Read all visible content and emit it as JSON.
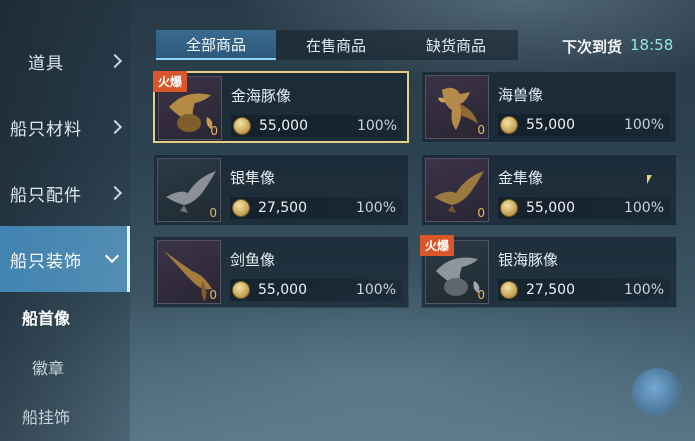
{
  "sidebar": {
    "categories": [
      {
        "label": "道具"
      },
      {
        "label": "船只材料"
      },
      {
        "label": "船只配件"
      },
      {
        "label": "船只装饰"
      }
    ],
    "subcategories": [
      {
        "label": "船首像"
      },
      {
        "label": "徽章"
      },
      {
        "label": "船挂饰"
      }
    ]
  },
  "tabs": [
    {
      "label": "全部商品"
    },
    {
      "label": "在售商品"
    },
    {
      "label": "缺货商品"
    }
  ],
  "restock": {
    "label": "下次到货",
    "time": "18:58"
  },
  "items": [
    {
      "name": "金海豚像",
      "price": "55,000",
      "percent": "100%",
      "count": "0",
      "badge": "火爆",
      "icon": "golden-dolphin-figurehead"
    },
    {
      "name": "海兽像",
      "price": "55,000",
      "percent": "100%",
      "count": "0",
      "badge": "",
      "icon": "sea-beast-figurehead"
    },
    {
      "name": "银隼像",
      "price": "27,500",
      "percent": "100%",
      "count": "0",
      "badge": "",
      "icon": "silver-falcon-figurehead"
    },
    {
      "name": "金隼像",
      "price": "55,000",
      "percent": "100%",
      "count": "0",
      "badge": "",
      "icon": "golden-falcon-figurehead"
    },
    {
      "name": "剑鱼像",
      "price": "55,000",
      "percent": "100%",
      "count": "0",
      "badge": "",
      "icon": "swordfish-figurehead"
    },
    {
      "name": "银海豚像",
      "price": "27,500",
      "percent": "100%",
      "count": "0",
      "badge": "火爆",
      "icon": "silver-dolphin-figurehead"
    }
  ],
  "colors": {
    "accent": "#8fd3ff",
    "hot_badge": "#d9562a",
    "selected_border": "#e6cf84",
    "gold": "#c9a559"
  }
}
